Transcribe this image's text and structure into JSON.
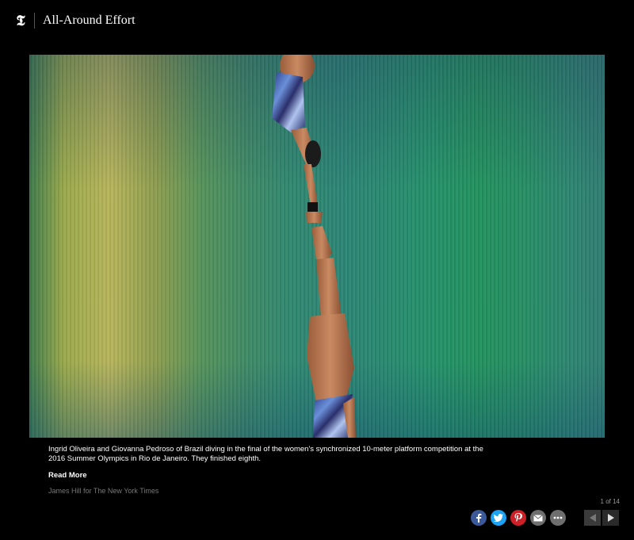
{
  "header": {
    "logo": "𝕿",
    "title": "All-Around Effort"
  },
  "photo": {
    "alt": "Two divers in synchronized vertical dive over blurred green and yellow background"
  },
  "caption": {
    "text": "Ingrid Oliveira and Giovanna Pedroso of Brazil diving in the final of the women's synchronized 10-meter platform competition at the 2016 Summer Olympics in Rio de Janeiro. They finished eighth.",
    "read_more": "Read More",
    "credit": "James Hill for The New York Times"
  },
  "pagination": {
    "counter": "1 of 14"
  },
  "share": {
    "facebook_icon": "facebook-icon",
    "twitter_icon": "twitter-icon",
    "pinterest_icon": "pinterest-icon",
    "email_icon": "email-icon",
    "more_icon": "more-icon",
    "colors": {
      "facebook": "#3b5998",
      "twitter": "#1da1f2",
      "pinterest": "#cb2027",
      "email": "#6e6e6e",
      "more": "#6e6e6e"
    }
  },
  "nav": {
    "prev_icon": "arrow-left-icon",
    "next_icon": "arrow-right-icon"
  }
}
